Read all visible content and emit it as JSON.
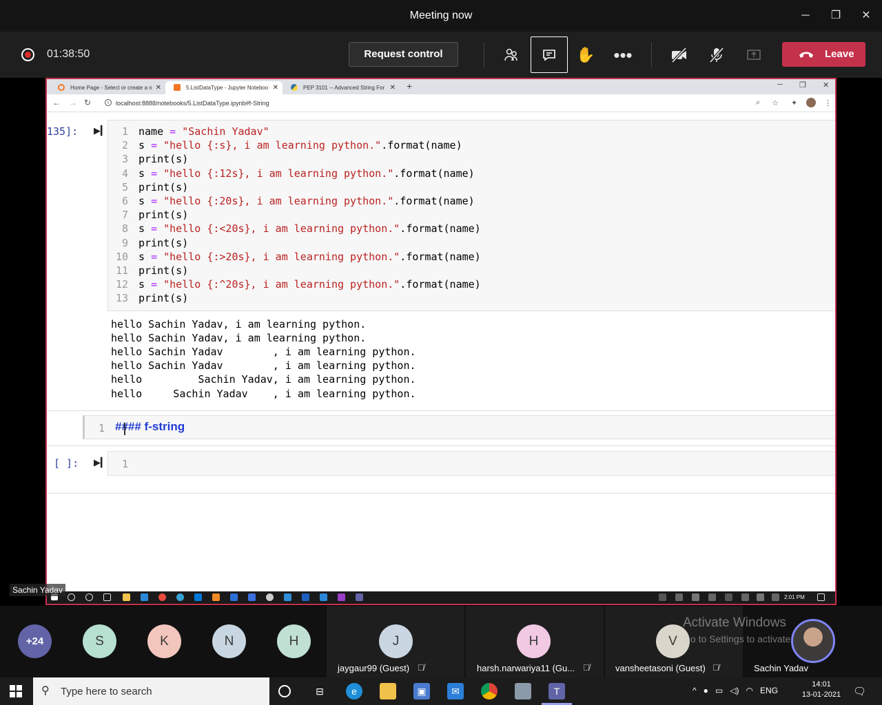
{
  "teams": {
    "window_title": "Meeting now",
    "timer": "01:38:50",
    "request_control_label": "Request control",
    "leave_label": "Leave",
    "controls": [
      "participants-icon",
      "chat-icon",
      "raise-hand-icon",
      "more-icon",
      "camera-off-icon",
      "mic-off-icon",
      "share-icon"
    ]
  },
  "browser": {
    "tabs": [
      {
        "label": "Home Page - Select or create a n"
      },
      {
        "label": "5.ListDataType - Jupyter Noteboo"
      },
      {
        "label": "PEP 3101 -- Advanced String For"
      }
    ],
    "url": "localhost:8888/notebooks/5.ListDataType.ipynb#f-String"
  },
  "notebook": {
    "cell1_prompt": "135]:",
    "cell1_lines": [
      "name = \"Sachin Yadav\"",
      "s = \"hello {:s}, i am learning python.\".format(name)",
      "print(s)",
      "s = \"hello {:12s}, i am learning python.\".format(name)",
      "print(s)",
      "s = \"hello {:20s}, i am learning python.\".format(name)",
      "print(s)",
      "s = \"hello {:<20s}, i am learning python.\".format(name)",
      "print(s)",
      "s = \"hello {:>20s}, i am learning python.\".format(name)",
      "print(s)",
      "s = \"hello {:^20s}, i am learning python.\".format(name)",
      "print(s)"
    ],
    "line_numbers": [
      "1",
      "2",
      "3",
      "4",
      "5",
      "6",
      "7",
      "8",
      "9",
      "10",
      "11",
      "12",
      "13"
    ],
    "output_lines": [
      "hello Sachin Yadav, i am learning python.",
      "hello Sachin Yadav, i am learning python.",
      "hello Sachin Yadav        , i am learning python.",
      "hello Sachin Yadav        , i am learning python.",
      "hello         Sachin Yadav, i am learning python.",
      "hello     Sachin Yadav    , i am learning python."
    ],
    "md_line_number": "1",
    "md_text": "#### f-string",
    "cell3_prompt": "[ ]:",
    "cell3_line_number": "1"
  },
  "remote_taskbar": {
    "time": "2:01 PM"
  },
  "presenter_name": "Sachin Yadav",
  "participants": {
    "overflow": "+24",
    "avatars": [
      {
        "initial": "S",
        "color": "#b6e0d0"
      },
      {
        "initial": "K",
        "color": "#f3c6bd"
      },
      {
        "initial": "N",
        "color": "#c7d6e0"
      },
      {
        "initial": "H",
        "color": "#bfe0d3"
      }
    ],
    "tiles": [
      {
        "initial": "J",
        "name": "jaygaur99 (Guest)",
        "color": "#c9d6e2"
      },
      {
        "initial": "H",
        "name": "harsh.narwariya11 (Gu...",
        "color": "#f1c9e3"
      },
      {
        "initial": "V",
        "name": "vansheetasoni (Guest)",
        "color": "#dad6cc"
      }
    ],
    "self_name": "Sachin Yadav",
    "activate_title": "Activate Windows",
    "activate_sub": "Go to Settings to activate Windows."
  },
  "windows": {
    "search_placeholder": "Type here to search",
    "tray_lang": "ENG",
    "clock_time": "14:01",
    "clock_date": "13-01-2021"
  }
}
